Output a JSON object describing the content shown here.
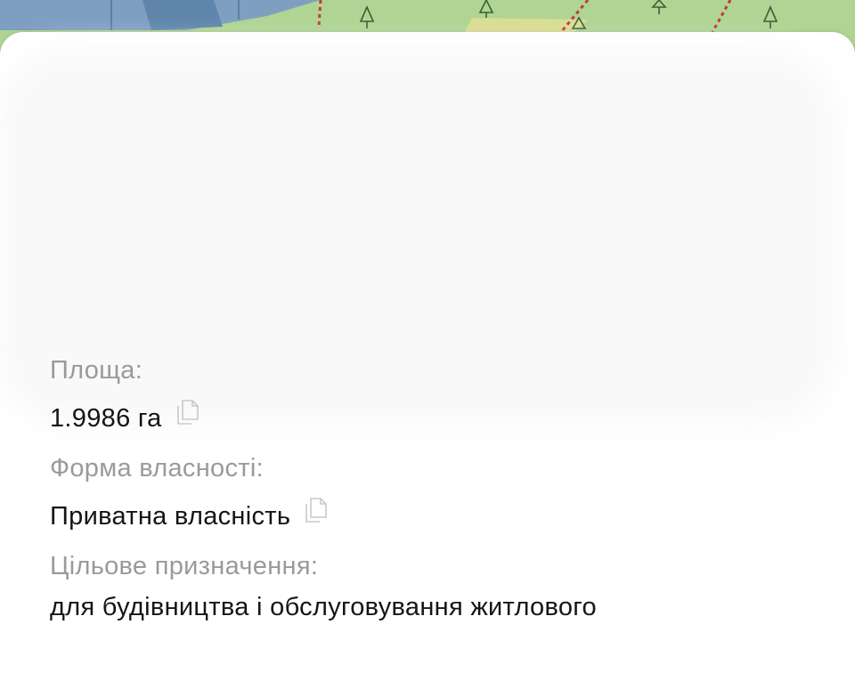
{
  "fields": [
    {
      "label": "Площа:",
      "value": "1.9986 га"
    },
    {
      "label": "Форма власності:",
      "value": "Приватна власність"
    },
    {
      "label": "Цільове призначення:",
      "value": "для будівництва і обслуговування житлового"
    }
  ],
  "icons": {
    "copy": "copy-icon",
    "tree": "tree-icon"
  },
  "colors": {
    "map_green": "#afd493",
    "map_blue": "#7f9fc1",
    "label_gray": "#9a9a9a",
    "value_black": "#151515",
    "sheet_white": "#ffffff"
  }
}
